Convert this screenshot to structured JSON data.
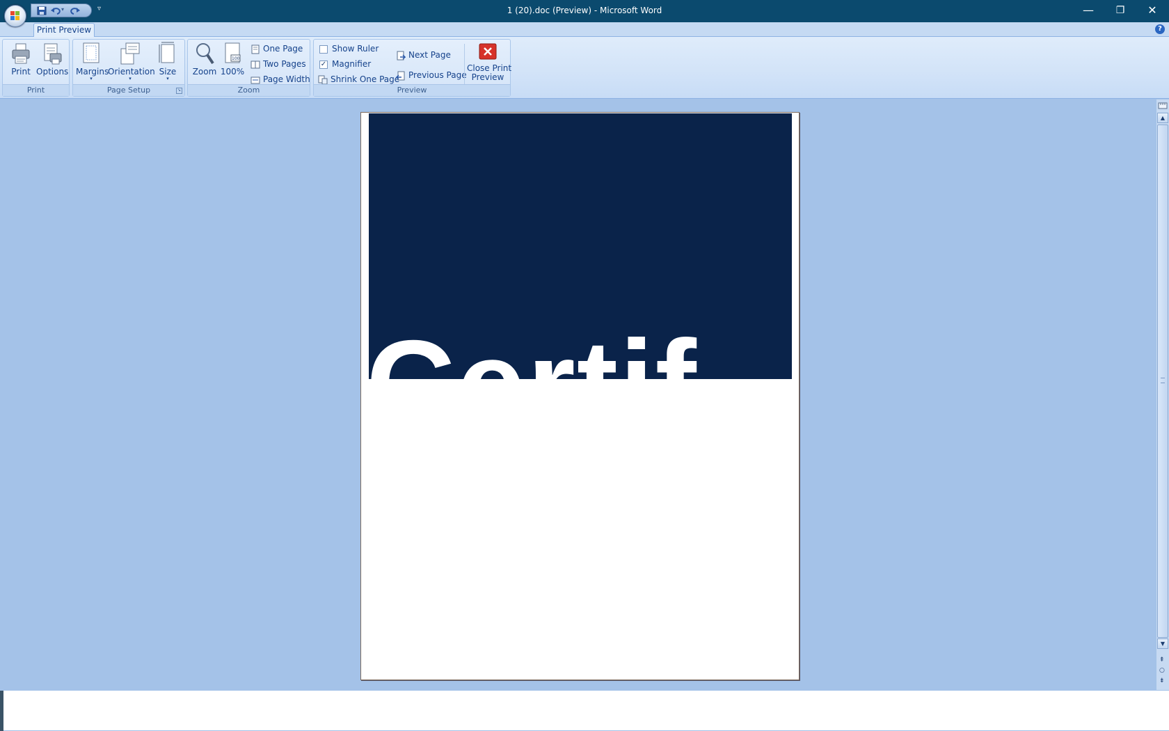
{
  "window": {
    "title": "1 (20).doc (Preview)  -  Microsoft Word",
    "minimize_glyph": "—",
    "restore_glyph": "❐",
    "close_glyph": "✕"
  },
  "qat": {
    "more_glyph": "▿"
  },
  "ribbon": {
    "tab_label": "Print Preview",
    "help_glyph": "?",
    "groups": {
      "print": {
        "label": "Print",
        "print_label": "Print",
        "options_label": "Options"
      },
      "page_setup": {
        "label": "Page Setup",
        "margins_label": "Margins",
        "orientation_label": "Orientation",
        "size_label": "Size"
      },
      "zoom": {
        "label": "Zoom",
        "zoom_label": "Zoom",
        "hundred_label": "100%",
        "one_page_label": "One Page",
        "two_pages_label": "Two Pages",
        "page_width_label": "Page Width"
      },
      "preview": {
        "label": "Preview",
        "show_ruler_label": "Show Ruler",
        "show_ruler_checked": false,
        "magnifier_label": "Magnifier",
        "magnifier_checked": true,
        "shrink_label": "Shrink One Page",
        "next_page_label": "Next Page",
        "previous_page_label": "Previous Page",
        "close_label_line1": "Close Print",
        "close_label_line2": "Preview"
      }
    }
  },
  "document": {
    "banner_color": "#0a234a",
    "visible_text": "Certif"
  },
  "colors": {
    "titlebar": "#0b4a6e",
    "workspace": "#a4c2e8",
    "ribbon": "#dfecfb",
    "accent_text": "#15428b"
  }
}
